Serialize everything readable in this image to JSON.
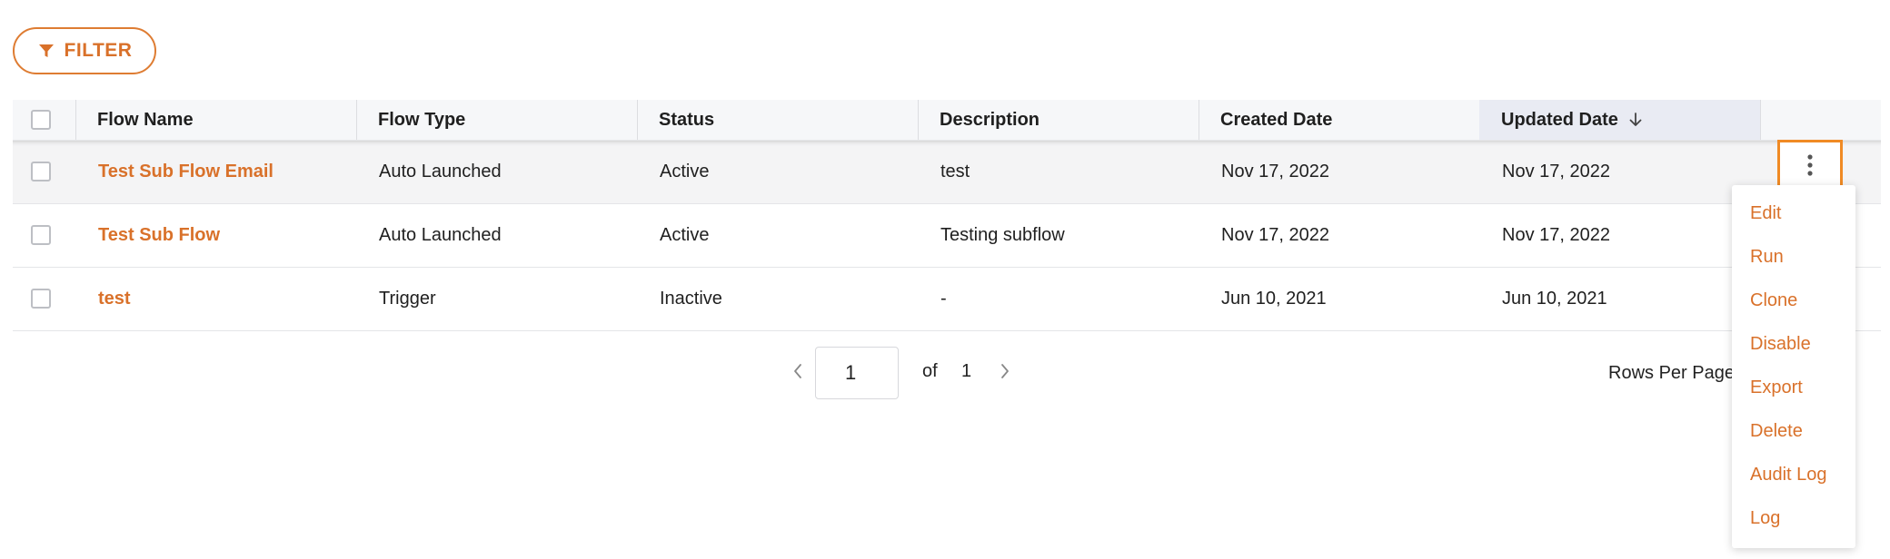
{
  "filter_button": {
    "label": "FILTER"
  },
  "table": {
    "columns": [
      "Flow Name",
      "Flow Type",
      "Status",
      "Description",
      "Created Date",
      "Updated Date"
    ],
    "sorted_column": "Updated Date",
    "sort_direction": "descending",
    "rows": [
      {
        "name": "Test Sub Flow Email",
        "type": "Auto Launched",
        "status": "Active",
        "description": "test",
        "created": "Nov 17, 2022",
        "updated": "Nov 17, 2022"
      },
      {
        "name": "Test Sub Flow",
        "type": "Auto Launched",
        "status": "Active",
        "description": "Testing subflow",
        "created": "Nov 17, 2022",
        "updated": "Nov 17, 2022"
      },
      {
        "name": "test",
        "type": "Trigger",
        "status": "Inactive",
        "description": "-",
        "created": "Jun 10, 2021",
        "updated": "Jun 10, 2021"
      }
    ]
  },
  "pagination": {
    "current_page": "1",
    "of_label": "of",
    "total_pages": "1",
    "rows_per_page_label": "Rows Per Page"
  },
  "row_menu": {
    "items": [
      "Edit",
      "Run",
      "Clone",
      "Disable",
      "Export",
      "Delete",
      "Audit Log",
      "Log"
    ]
  },
  "colors": {
    "accent": "#d9712a",
    "focus_outline": "#f08a24",
    "header_bg": "#f6f7f9",
    "sorted_header_bg": "#e9ebf3"
  },
  "icons": {
    "filter": "filter-icon",
    "sort": "arrow-down-icon",
    "row_actions": "more-vertical-icon",
    "prev": "chevron-left-icon",
    "next": "chevron-right-icon"
  }
}
